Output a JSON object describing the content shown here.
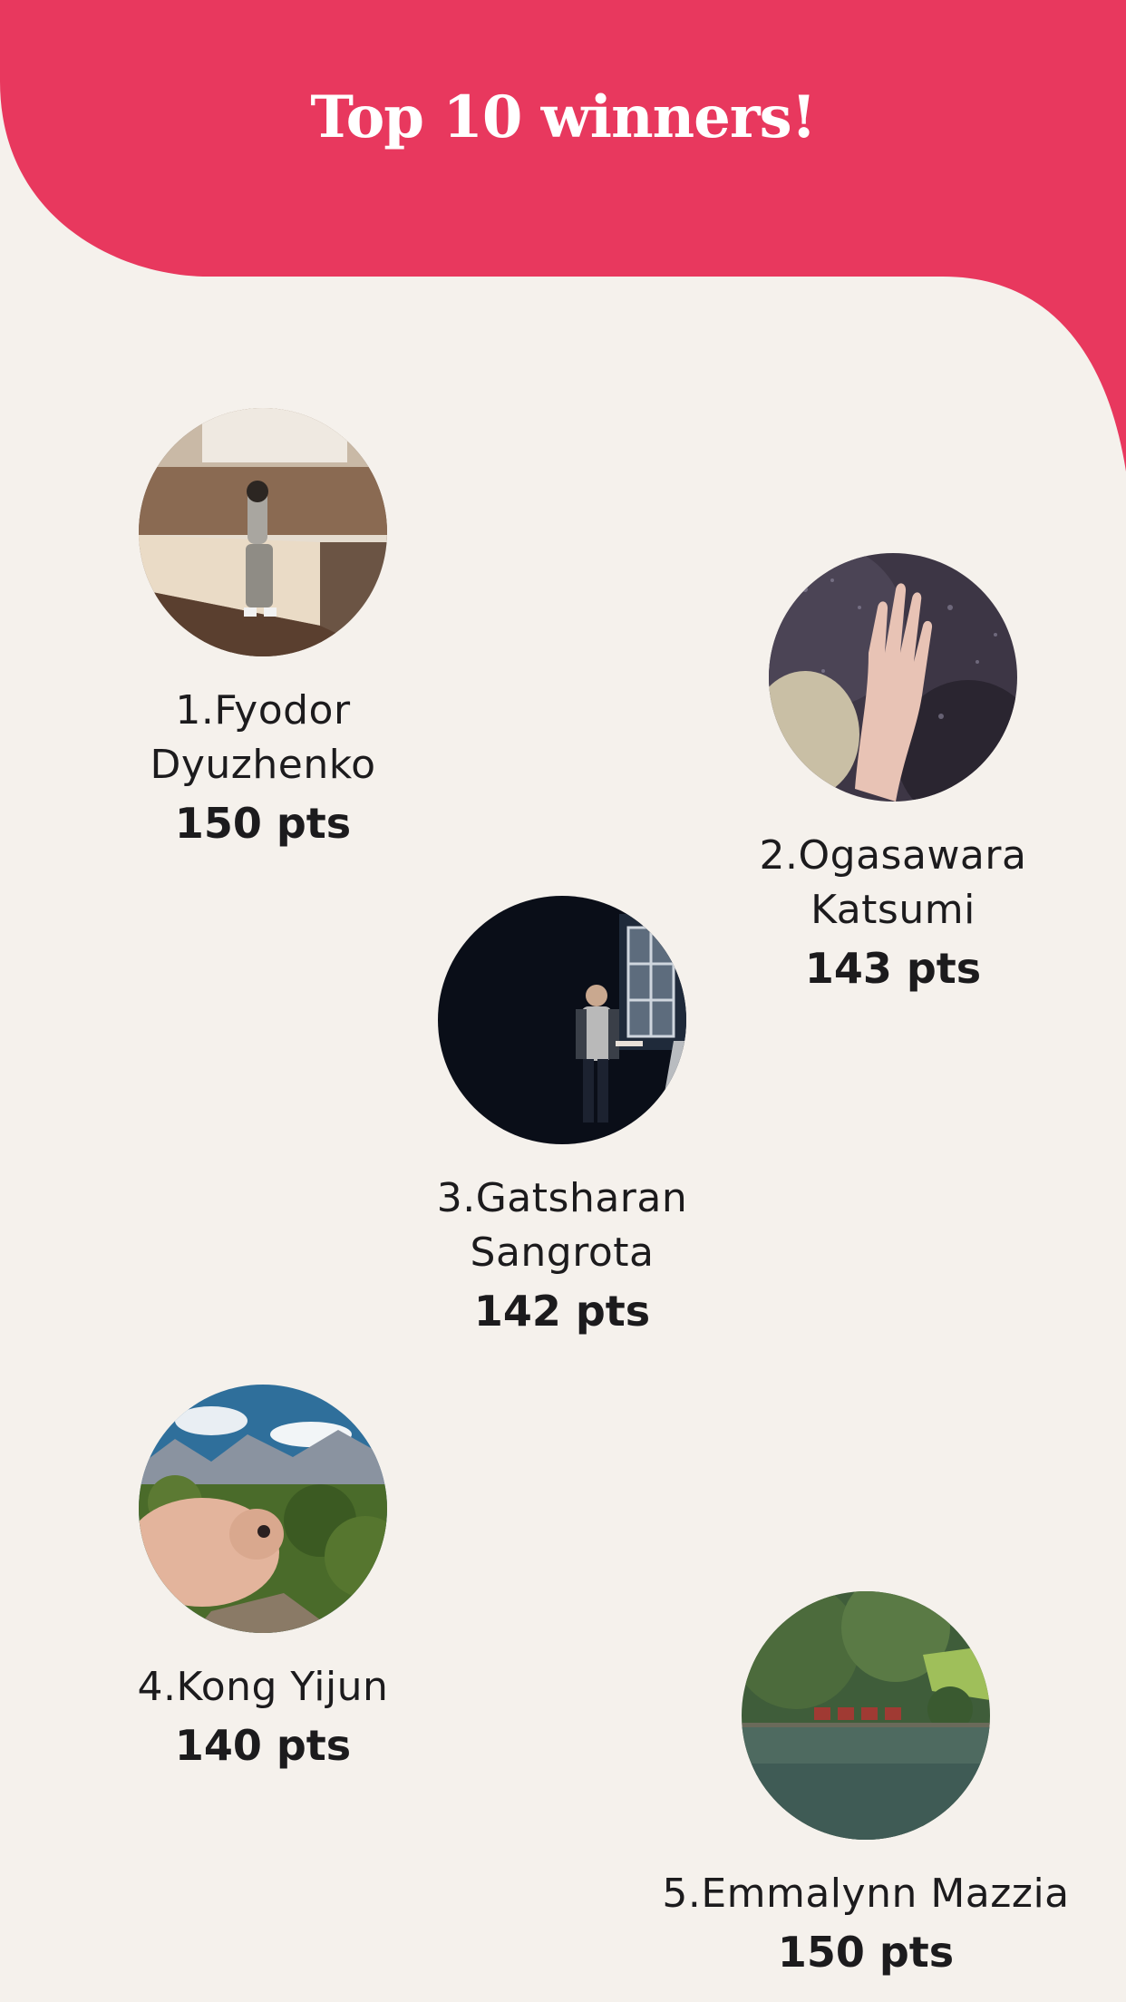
{
  "header": {
    "title": "Top 10 winners!",
    "accent_color": "#e8385e"
  },
  "winners": [
    {
      "rank_name": "1.Fyodor\nDyuzhenko",
      "points": "150 pts",
      "photo": "woman-leaning-on-railing-photo"
    },
    {
      "rank_name": "2.Ogasawara\nKatsumi",
      "points": "143 pts",
      "photo": "hand-on-rainy-window-photo"
    },
    {
      "rank_name": "3.Gatsharan\nSangrota",
      "points": "142 pts",
      "photo": "man-by-window-in-dark-room-photo"
    },
    {
      "rank_name": "4.Kong Yijun",
      "points": "140 pts",
      "photo": "sheep-in-mountains-photo"
    },
    {
      "rank_name": "5.Emmalynn Mazzia",
      "points": "150 pts",
      "photo": "lake-with-houses-photo"
    }
  ]
}
